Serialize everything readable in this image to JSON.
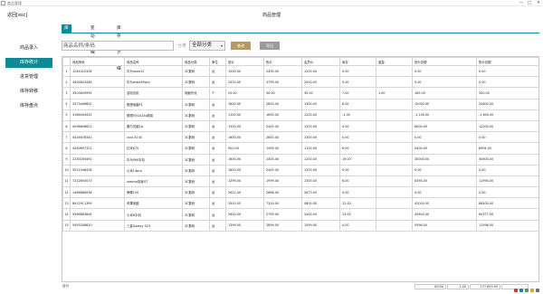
{
  "window": {
    "title": "商品管理",
    "minimize": "—",
    "maximize": "□",
    "close": "✕"
  },
  "header": {
    "back": "返回[esc]",
    "title": "商品管理"
  },
  "sidebar": {
    "items": [
      {
        "label": "商品录入",
        "active": false
      },
      {
        "label": "库存统计",
        "active": true
      },
      {
        "label": "进货管理",
        "active": false
      },
      {
        "label": "库存转移",
        "active": false
      },
      {
        "label": "库存盘点",
        "active": false
      }
    ]
  },
  "tabs": [
    {
      "label": "库存统计",
      "active": true
    },
    {
      "label": "变动明细",
      "active": false
    },
    {
      "label": "库存统计明细",
      "active": false
    }
  ],
  "filters": {
    "search_placeholder": "商品名称/条码",
    "category_label": "分类",
    "category_value": "全部分类",
    "query_label": "查询",
    "export_label": "导出"
  },
  "table": {
    "columns": [
      "",
      "商品条码",
      "商品名称",
      "商品分类",
      "单位",
      "进价",
      "售价",
      "会员价",
      "库存",
      "重量",
      "进价总额",
      "售价总额"
    ],
    "rows": [
      [
        "1",
        "1244320328",
        "华为nova12",
        "3C数码",
        "台",
        "1500.00",
        "2400.00",
        "1200.00",
        "0.00",
        "",
        "0.00",
        "0.00"
      ],
      [
        "2",
        "3404843446",
        "华为mateX5pro",
        "3C数码",
        "台",
        "2320.00",
        "3799.00",
        "2000.00",
        "0.00",
        "",
        "0.00",
        "0.00"
      ],
      [
        "3",
        "3503659995",
        "富哈总机",
        "电脑外设",
        "个",
        "25.00",
        "50.00",
        "35.00",
        "7.00",
        "1.00",
        "165.00",
        "350.00"
      ],
      [
        "4",
        "3473498602",
        "联想电脑P1",
        "3C数码",
        "台",
        "1600.00",
        "2600.00",
        "1300.00",
        "8.00",
        "",
        "12000.00",
        "20800.00"
      ],
      [
        "5",
        "3166404432",
        "联想YOGA14s精英",
        "3C数码",
        "台",
        "1100.00",
        "1600.00",
        "1200.00",
        "-1.00",
        "",
        "-1,100.00",
        "-1,600.00"
      ],
      [
        "6",
        "4098606621",
        "戴尔灵越16",
        "3C数码",
        "台",
        "1500.00",
        "2400.00",
        "1200.00",
        "4.00",
        "",
        "6000.00",
        "12000.00"
      ],
      [
        "7",
        "4434678343",
        "vivo X100",
        "3C数码",
        "台",
        "1600.00",
        "2600.00",
        "1300.00",
        "0.00",
        "",
        "0.00",
        "0.00"
      ],
      [
        "8",
        "4260697321",
        "红米K70",
        "3C数码",
        "台",
        "900.00",
        "1499.00",
        "1100.00",
        "6.00",
        "",
        "5400.00",
        "8994.00"
      ],
      [
        "9",
        "2235164491",
        "华为P60手机",
        "3C数码",
        "台",
        "1600.00",
        "2400.00",
        "1200.00",
        "19.00",
        "",
        "30000.00",
        "45600.00"
      ],
      [
        "10",
        "5521046426",
        "小米14pro",
        "3C数码",
        "台",
        "1600.00",
        "2400.00",
        "1200.00",
        "0.00",
        "",
        "0.00",
        "0.00"
      ],
      [
        "11",
        "7212654573",
        "realme真我GT",
        "3C数码",
        "台",
        "1399.00",
        "1999.00",
        "1300.00",
        "6.00",
        "",
        "8394.00",
        "11994.00"
      ],
      [
        "12",
        "1466888936",
        "荣耀100",
        "3C数码",
        "台",
        "2622.00",
        "2666.00",
        "2673.00",
        "0.00",
        "",
        "0.00",
        "0.00"
      ],
      [
        "13",
        "8912911399",
        "苹果电脑",
        "3C数码",
        "台",
        "3500.00",
        "7200.00",
        "4800.00",
        "12.00",
        "",
        "42000.00",
        "86400.00"
      ],
      [
        "14",
        "9366883844",
        "小米8手机",
        "3C数码",
        "台",
        "2600.00",
        "2799.00",
        "2400.00",
        "23.00",
        "",
        "45600.00",
        "64377.00"
      ],
      [
        "15",
        "5493306610",
        "三星Galaxy S23",
        "3C数码",
        "台",
        "1399.00",
        "2899.00",
        "1599.00",
        "4.00",
        "",
        "5596.00",
        "11596.00"
      ]
    ]
  },
  "footer": {
    "label": "合计",
    "qty": "89.00",
    "weight": "1.00",
    "cost_total": "177,655.00",
    "sale_total": ""
  },
  "colors": {
    "accent": "#0e8a96",
    "query_button": "#b59a66",
    "export_button": "#9b9b9b"
  }
}
